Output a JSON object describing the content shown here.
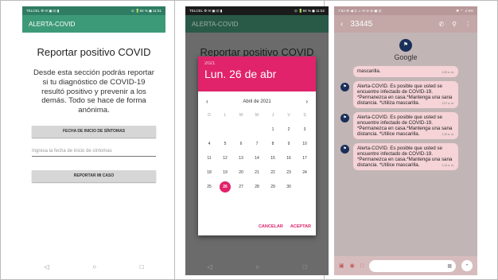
{
  "phone1": {
    "status_left": "TELCEL ⚙ ✉ ▣ ⊡ ▮",
    "status_right": "⊙ 🔋84 % ◼ 11:51",
    "app_title": "ALERTA-COVID",
    "heading": "Reportar positivo COVID",
    "description": "Desde esta sección podrás reportar si tu diagnóstico de COVID-19 resultó positivo y prevenir a los demás. Todo se hace de forma anónima.",
    "date_button": "FECHA DE INICIO DE SÍNTOMAS",
    "date_placeholder": "Ingresa la fecha de inicio de síntomas",
    "report_button": "REPORTAR MI CASO",
    "nav": [
      "◁",
      "○",
      "□"
    ]
  },
  "phone2": {
    "status_left": "TELCEL ⚙ ✉ ▣ ⊡ ▮",
    "status_right": "⊙ 🔋84 % ◼ 11:52",
    "app_title": "ALERTA-COVID",
    "heading": "Reportar positivo COVID",
    "dialog_year": "2021",
    "dialog_date": "Lun. 26 de abr",
    "month_label": "Abril de 2021",
    "prev_arrow": "‹",
    "next_arrow": "›",
    "weekdays": [
      "D",
      "L",
      "M",
      "M",
      "J",
      "V",
      "S"
    ],
    "days": [
      "",
      "",
      "",
      "",
      "1",
      "2",
      "3",
      "4",
      "5",
      "6",
      "7",
      "8",
      "9",
      "10",
      "11",
      "12",
      "13",
      "14",
      "15",
      "16",
      "17",
      "18",
      "19",
      "20",
      "21",
      "22",
      "23",
      "24",
      "25",
      "26",
      "27",
      "28",
      "29",
      "30",
      ""
    ],
    "selected_day": "26",
    "cancel": "CANCELAR",
    "accept": "ACEPTAR",
    "nav": [
      "◁",
      "○",
      "□"
    ],
    "accent_color": "#e0236a"
  },
  "phone3": {
    "status_left": "7:53 ⚙ ◀ ⊙ ⊥ ✉ ⊘ ⊚ ▣ ⊡",
    "status_right": "✱ ⌔ .ıl 5%",
    "back_icon": "‹",
    "contact_number": "33445",
    "sender_name": "Google",
    "messages": [
      {
        "text": "mascarilla.",
        "time": "1:00 a. m."
      },
      {
        "text": "Alerta-COVID. Es posible que usted se encuentre infectado de COVID-19. *Permanezca en casa.*Mantenga una sana distancia. *Utiliza mascarilla.",
        "time": "1:07 a. m."
      },
      {
        "text": "Alerta-COVID. Es posible que usted se encuentre infectado de COVID-19. *Permanezca en casa.*Mantenga una sana distancia. *Utilice mascarilla.",
        "time": "1:10 a. m."
      },
      {
        "text": "Alerta-COVID. Es posible que usted se encuentre infectado de COVID-19. *Permanezca en casa.*Mantenga una sana distancia. *Utilice mascarilla.",
        "time": "1:14 a. m."
      }
    ]
  }
}
